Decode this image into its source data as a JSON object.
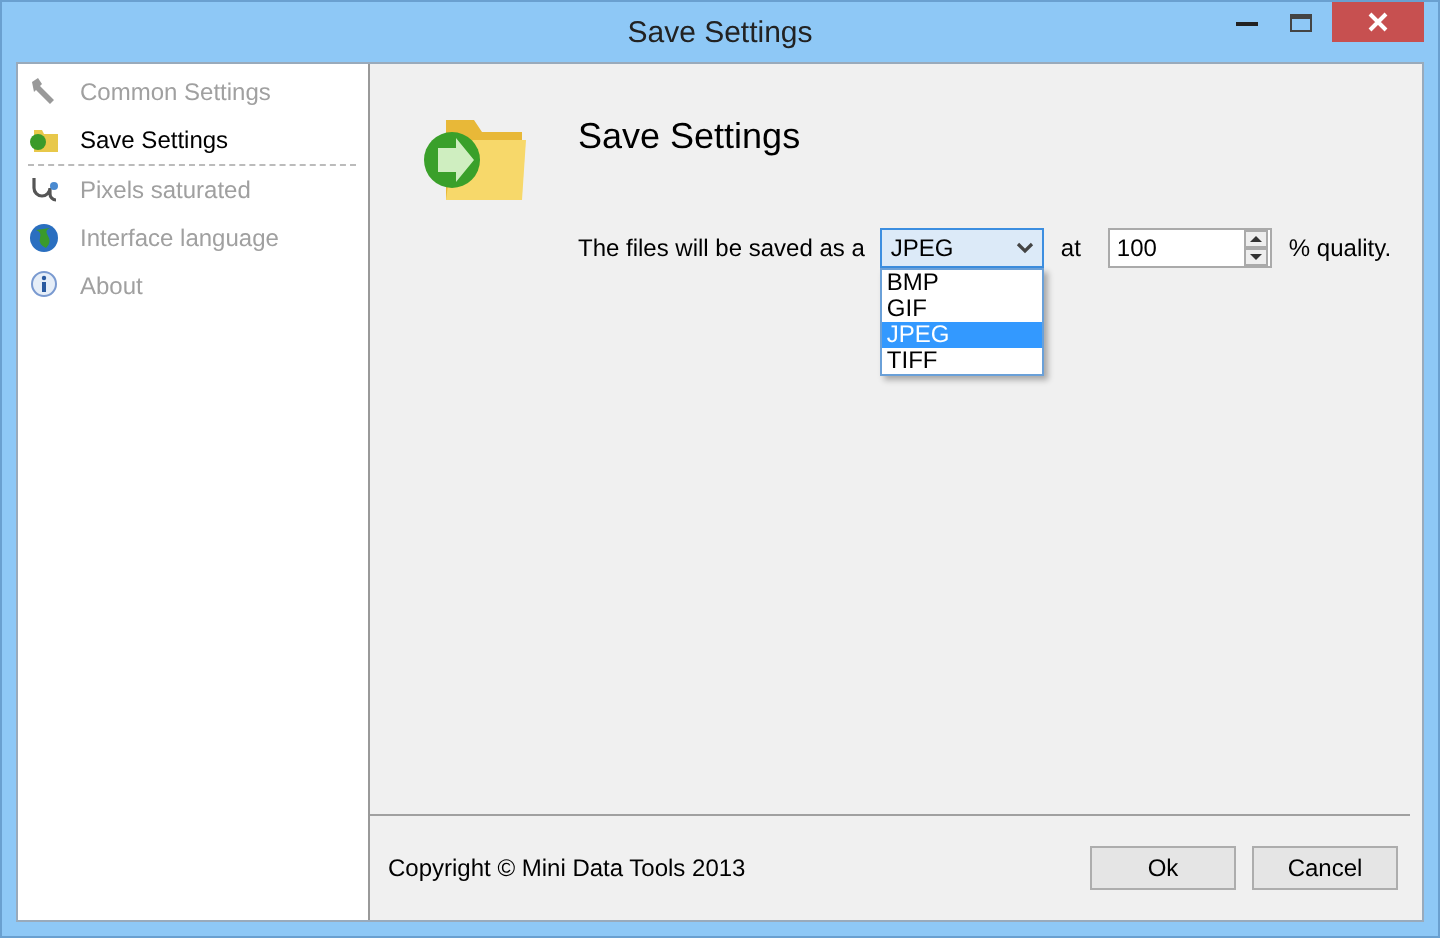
{
  "window": {
    "title": "Save Settings"
  },
  "sidebar": {
    "items": [
      {
        "label": "Common Settings",
        "selected": false
      },
      {
        "label": "Save Settings",
        "selected": true
      },
      {
        "label": "Pixels saturated",
        "selected": false
      },
      {
        "label": "Interface language",
        "selected": false
      },
      {
        "label": "About",
        "selected": false
      }
    ]
  },
  "page": {
    "heading": "Save Settings",
    "sentence_start": "The files will be saved as a",
    "format_dropdown": {
      "value": "JPEG",
      "expanded": true,
      "options": [
        {
          "label": "BMP",
          "selected": false
        },
        {
          "label": "GIF",
          "selected": false
        },
        {
          "label": "JPEG",
          "selected": true
        },
        {
          "label": "TIFF",
          "selected": false
        }
      ]
    },
    "at_label": "at",
    "quality_field": {
      "value": "100"
    },
    "sentence_end": "% quality."
  },
  "footer": {
    "copyright": "Copyright © Mini Data Tools 2013",
    "buttons": [
      "Ok",
      "Cancel"
    ]
  }
}
